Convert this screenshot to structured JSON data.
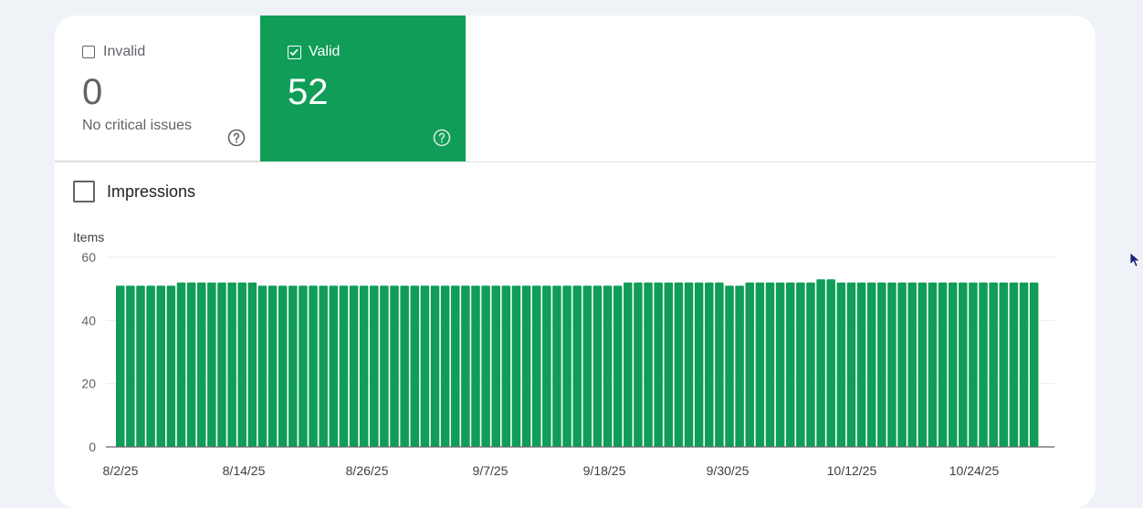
{
  "tiles": {
    "invalid": {
      "label": "Invalid",
      "value": "0",
      "subtitle": "No critical issues",
      "checked": false
    },
    "valid": {
      "label": "Valid",
      "value": "52",
      "checked": true,
      "color": "#0f9d58"
    }
  },
  "impressions": {
    "label": "Impressions",
    "checked": false
  },
  "chart_data": {
    "type": "bar",
    "ylabel": "Items",
    "ylim": [
      0,
      60
    ],
    "yticks": [
      0,
      20,
      40,
      60
    ],
    "x_tick_labels": [
      "8/2/25",
      "8/14/25",
      "8/26/25",
      "9/7/25",
      "9/18/25",
      "9/30/25",
      "10/12/25",
      "10/24/25"
    ],
    "bar_color": "#0f9d58",
    "values": [
      51,
      51,
      51,
      51,
      51,
      51,
      52,
      52,
      52,
      52,
      52,
      52,
      52,
      52,
      51,
      51,
      51,
      51,
      51,
      51,
      51,
      51,
      51,
      51,
      51,
      51,
      51,
      51,
      51,
      51,
      51,
      51,
      51,
      51,
      51,
      51,
      51,
      51,
      51,
      51,
      51,
      51,
      51,
      51,
      51,
      51,
      51,
      51,
      51,
      51,
      52,
      52,
      52,
      52,
      52,
      52,
      52,
      52,
      52,
      52,
      51,
      51,
      52,
      52,
      52,
      52,
      52,
      52,
      52,
      53,
      53,
      52,
      52,
      52,
      52,
      52,
      52,
      52,
      52,
      52,
      52,
      52,
      52,
      52,
      52,
      52,
      52,
      52,
      52,
      52,
      52
    ]
  }
}
